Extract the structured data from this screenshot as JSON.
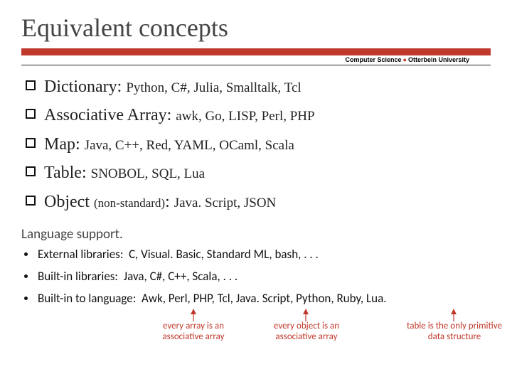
{
  "title": "Equivalent concepts",
  "header_org_left": "Computer Science",
  "header_org_right": "Otterbein University",
  "concepts": [
    {
      "name": "Dictionary",
      "detail": "Python, C#, Julia, Smalltalk, Tcl"
    },
    {
      "name": "Associative Array",
      "detail": "awk, Go, LISP, Perl, PHP"
    },
    {
      "name": "Map",
      "detail": "Java, C++, Red, YAML, OCaml, Scala"
    },
    {
      "name": "Table",
      "detail": "SNOBOL, SQL, Lua"
    },
    {
      "name": "Object",
      "paren": "(non-standard)",
      "detail": "Java. Script, JSON"
    }
  ],
  "support_heading": "Language support.",
  "support": [
    {
      "label": "External libraries:",
      "langs": "C, Visual. Basic, Standard ML, bash, . . ."
    },
    {
      "label": "Built-in libraries:",
      "langs": "Java, C#, C++, Scala, . . ."
    },
    {
      "label": "Built-in to language:",
      "langs": "Awk, Perl, PHP, Tcl, Java. Script, Python, Ruby, Lua."
    }
  ],
  "annotations": [
    "every array is an associative array",
    "every object is an associative array",
    "table is the only primitive data structure"
  ]
}
